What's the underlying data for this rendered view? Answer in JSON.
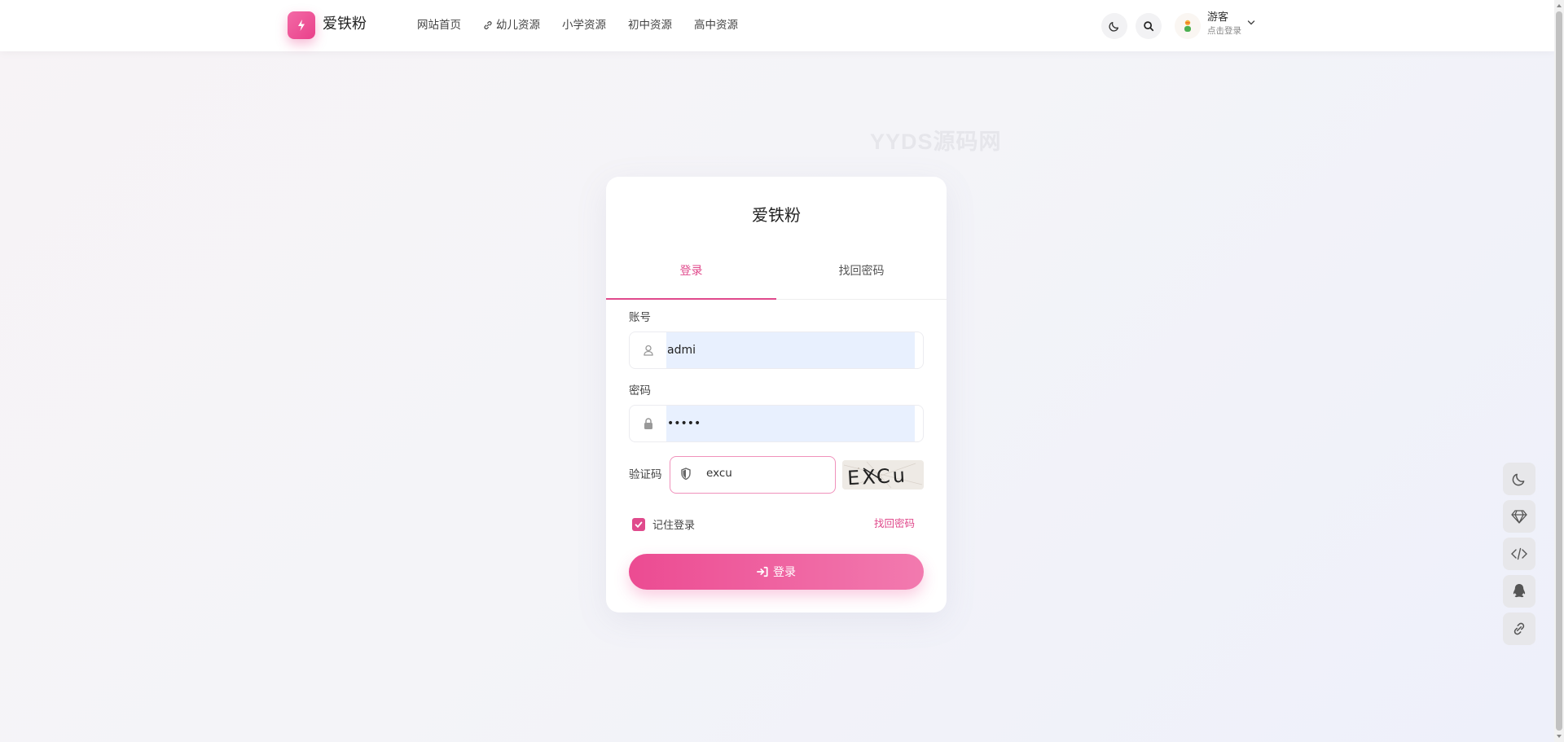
{
  "header": {
    "logo_text": "爱铁粉",
    "nav": [
      {
        "label": "网站首页",
        "icon": ""
      },
      {
        "label": "幼儿资源",
        "icon": "link-icon"
      },
      {
        "label": "小学资源",
        "icon": ""
      },
      {
        "label": "初中资源",
        "icon": ""
      },
      {
        "label": "高中资源",
        "icon": ""
      }
    ],
    "user": {
      "name": "游客",
      "sub": "点击登录"
    }
  },
  "watermark": "YYDS源码网",
  "card": {
    "title": "爱铁粉",
    "tabs": [
      "登录",
      "找回密码"
    ],
    "account_label": "账号",
    "account_value": "admi",
    "password_label": "密码",
    "password_value": "•••••",
    "captcha_label": "验证码",
    "captcha_value": "excu",
    "captcha_image_text": "EXCu",
    "remember_label": "记住登录",
    "forgot_label": "找回密码",
    "login_label": "登录"
  },
  "colors": {
    "accent": "#e04a8c",
    "autofill": "#e8f0fe"
  },
  "side_toolbar": [
    "moon-icon",
    "diamond-icon",
    "code-icon",
    "qq-icon",
    "link-icon"
  ]
}
